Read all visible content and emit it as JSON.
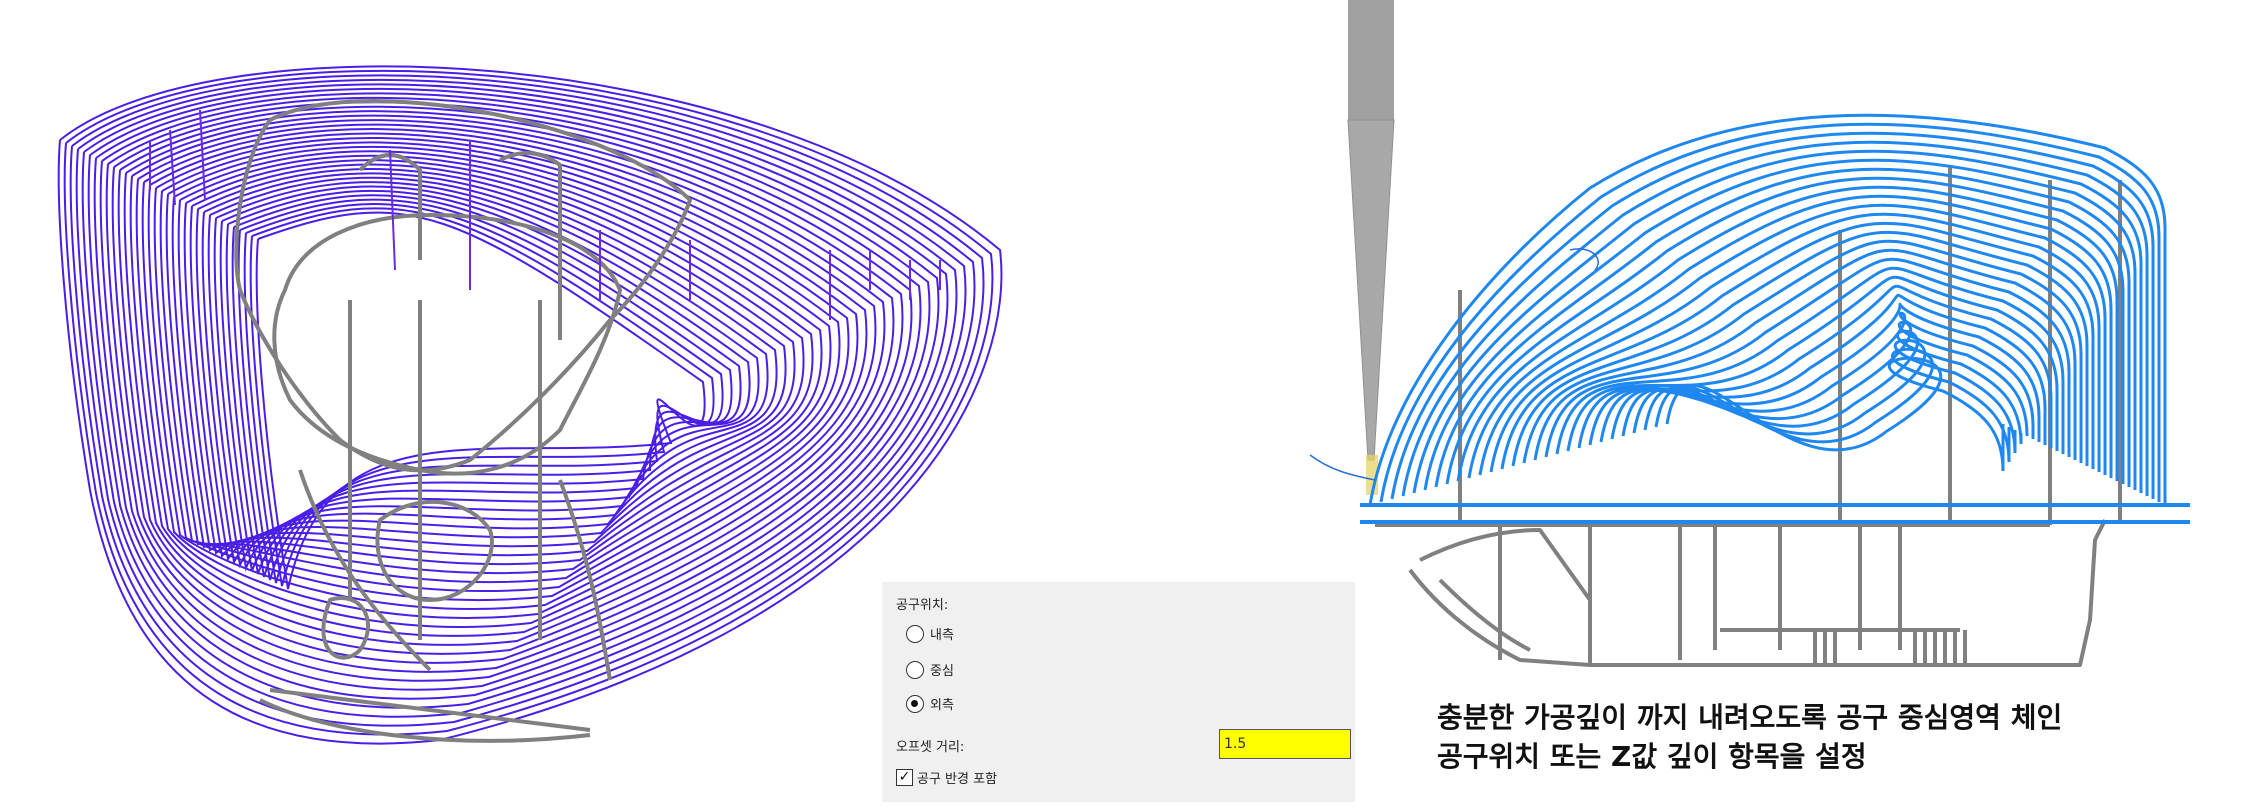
{
  "panel": {
    "position_label": "공구위치:",
    "options": [
      {
        "label": "내측",
        "checked": false
      },
      {
        "label": "중심",
        "checked": false
      },
      {
        "label": "외측",
        "checked": true
      }
    ],
    "offset_label": "오프셋 거리:",
    "offset_value": "1.5",
    "include_radius_label": "공구 반경 포함",
    "include_radius_checked": true
  },
  "note": {
    "line1": "충분한 가공깊이 까지 내려오도록 공구 중심영역 체인",
    "line2": "공구위치 또는 Z값 깊이 항목을 설정"
  },
  "colors": {
    "toolpath_left": "#4a1ee6",
    "toolpath_right": "#1e88f0",
    "model": "#808080",
    "tool": "#a0a0a0",
    "offset_highlight": "#ffff00"
  }
}
